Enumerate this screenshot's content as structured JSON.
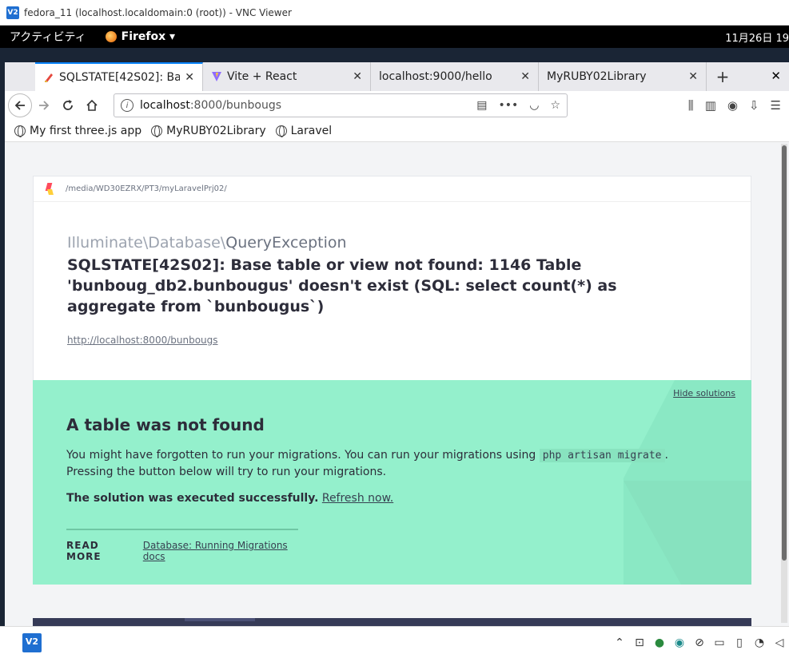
{
  "vnc": {
    "title": "fedora_11 (localhost.localdomain:0 (root)) - VNC Viewer",
    "logo": "V2"
  },
  "gnome": {
    "activities": "アクティビティ",
    "app": "Firefox ▾",
    "clock": "11月26日  19"
  },
  "tabs": [
    {
      "label": "SQLSTATE[42S02]: Ba",
      "icon": "ignition-icon",
      "active": true
    },
    {
      "label": "Vite + React",
      "icon": "vite-icon",
      "active": false
    },
    {
      "label": "localhost:9000/hello",
      "icon": "none",
      "active": false
    },
    {
      "label": "MyRUBY02Library",
      "icon": "none",
      "active": false
    }
  ],
  "urlbar": {
    "host": "localhost",
    "rest": ":8000/bunbougs"
  },
  "bookmarks": [
    {
      "label": "My first three.js app"
    },
    {
      "label": "MyRUBY02Library"
    },
    {
      "label": "Laravel"
    }
  ],
  "error": {
    "path": "/media/WD30EZRX/PT3/myLaravelPrj02/",
    "class_prefix": "Illuminate\\Database\\",
    "class_name": "QueryException",
    "message": "SQLSTATE[42S02]: Base table or view not found: 1146 Table 'bunboug_db2.bunbougus' doesn't exist (SQL: select count(*) as aggregate from `bunbougus`)",
    "url": "http://localhost:8000/bunbougs"
  },
  "solution": {
    "hide": "Hide solutions",
    "title": "A table was not found",
    "text_before": "You might have forgotten to run your migrations. You can run your migrations using ",
    "code": "php artisan migrate",
    "text_after": ".",
    "text_line2": "Pressing the button below will try to run your migrations.",
    "success": "The solution was executed successfully.",
    "refresh": "Refresh now.",
    "read_more": "READ MORE",
    "doc_link": "Database: Running Migrations docs"
  },
  "taskbar": {
    "vnc": "V2"
  }
}
